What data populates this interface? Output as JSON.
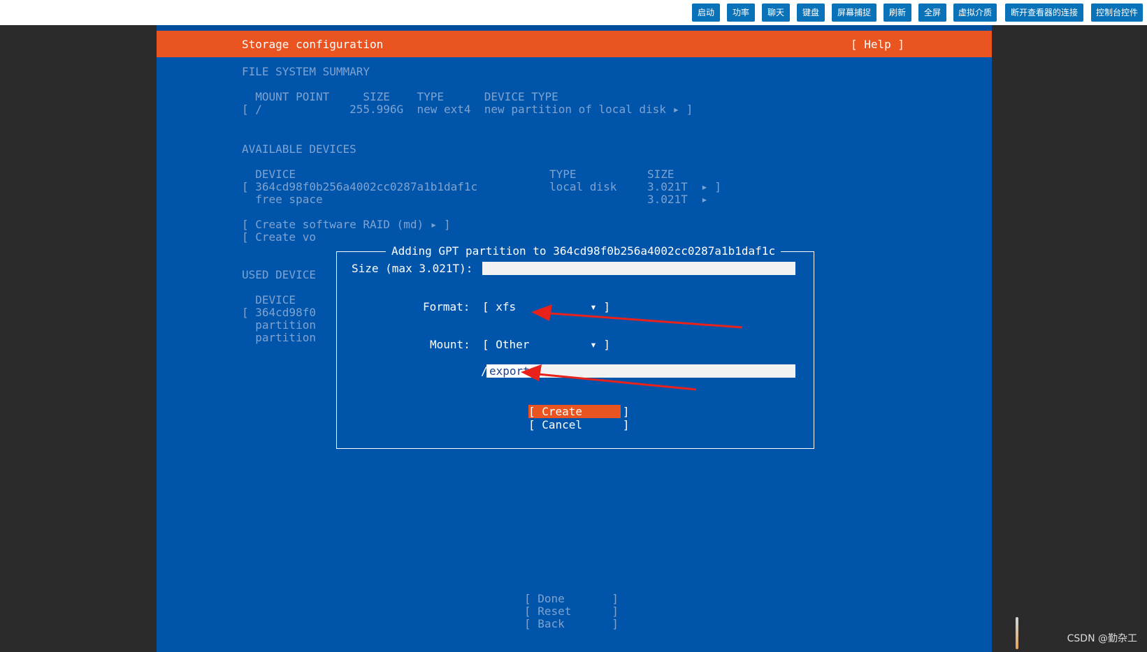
{
  "toolbar": {
    "buttons": [
      "启动",
      "功率",
      "聊天",
      "键盘",
      "屏幕捕捉",
      "刷新",
      "全屏",
      "虚拟介质",
      "断开查看器的连接",
      "控制台控件"
    ]
  },
  "header": {
    "title": "Storage configuration",
    "help": "[ Help ]"
  },
  "fs_summary": {
    "heading": "FILE SYSTEM SUMMARY",
    "columns": "  MOUNT POINT     SIZE    TYPE      DEVICE TYPE",
    "row": "[ /             255.996G  new ext4  new partition of local disk ▸ ]"
  },
  "available": {
    "heading": "AVAILABLE DEVICES",
    "columns_device": "  DEVICE",
    "columns_type": "TYPE",
    "columns_size": "SIZE",
    "device_row": "[ 364cd98f0b256a4002cc0287a1b1daf1c",
    "device_type": "local disk",
    "device_size": "3.021T  ▸ ]",
    "free_label": "  free space",
    "free_size": "3.021T  ▸",
    "raid": "[ Create software RAID (md) ▸ ]",
    "volume": "[ Create vo"
  },
  "used": {
    "heading": "USED DEVICE",
    "columns": "  DEVICE",
    "row1": "[ 364cd98f0",
    "row2": "  partition",
    "row3": "  partition"
  },
  "dialog": {
    "title": "Adding GPT partition to 364cd98f0b256a4002cc0287a1b1daf1c",
    "size_label": "Size (max 3.021T):",
    "size_value": "",
    "format_label": "Format:",
    "format_value": "[ xfs           ▾ ]",
    "mount_label": "Mount:",
    "mount_value": "[ Other         ▾ ]",
    "path_prefix": "/",
    "path_value": "export",
    "create": "[ Create      ]",
    "cancel": "[ Cancel      ]"
  },
  "footer": {
    "done": "[ Done       ]",
    "reset": "[ Reset      ]",
    "back": "[ Back       ]"
  },
  "watermark": "CSDN @勤杂工",
  "colors": {
    "screen_bg": "#0055ab",
    "accent": "#e95420",
    "annotation_arrow": "#e8221b"
  }
}
